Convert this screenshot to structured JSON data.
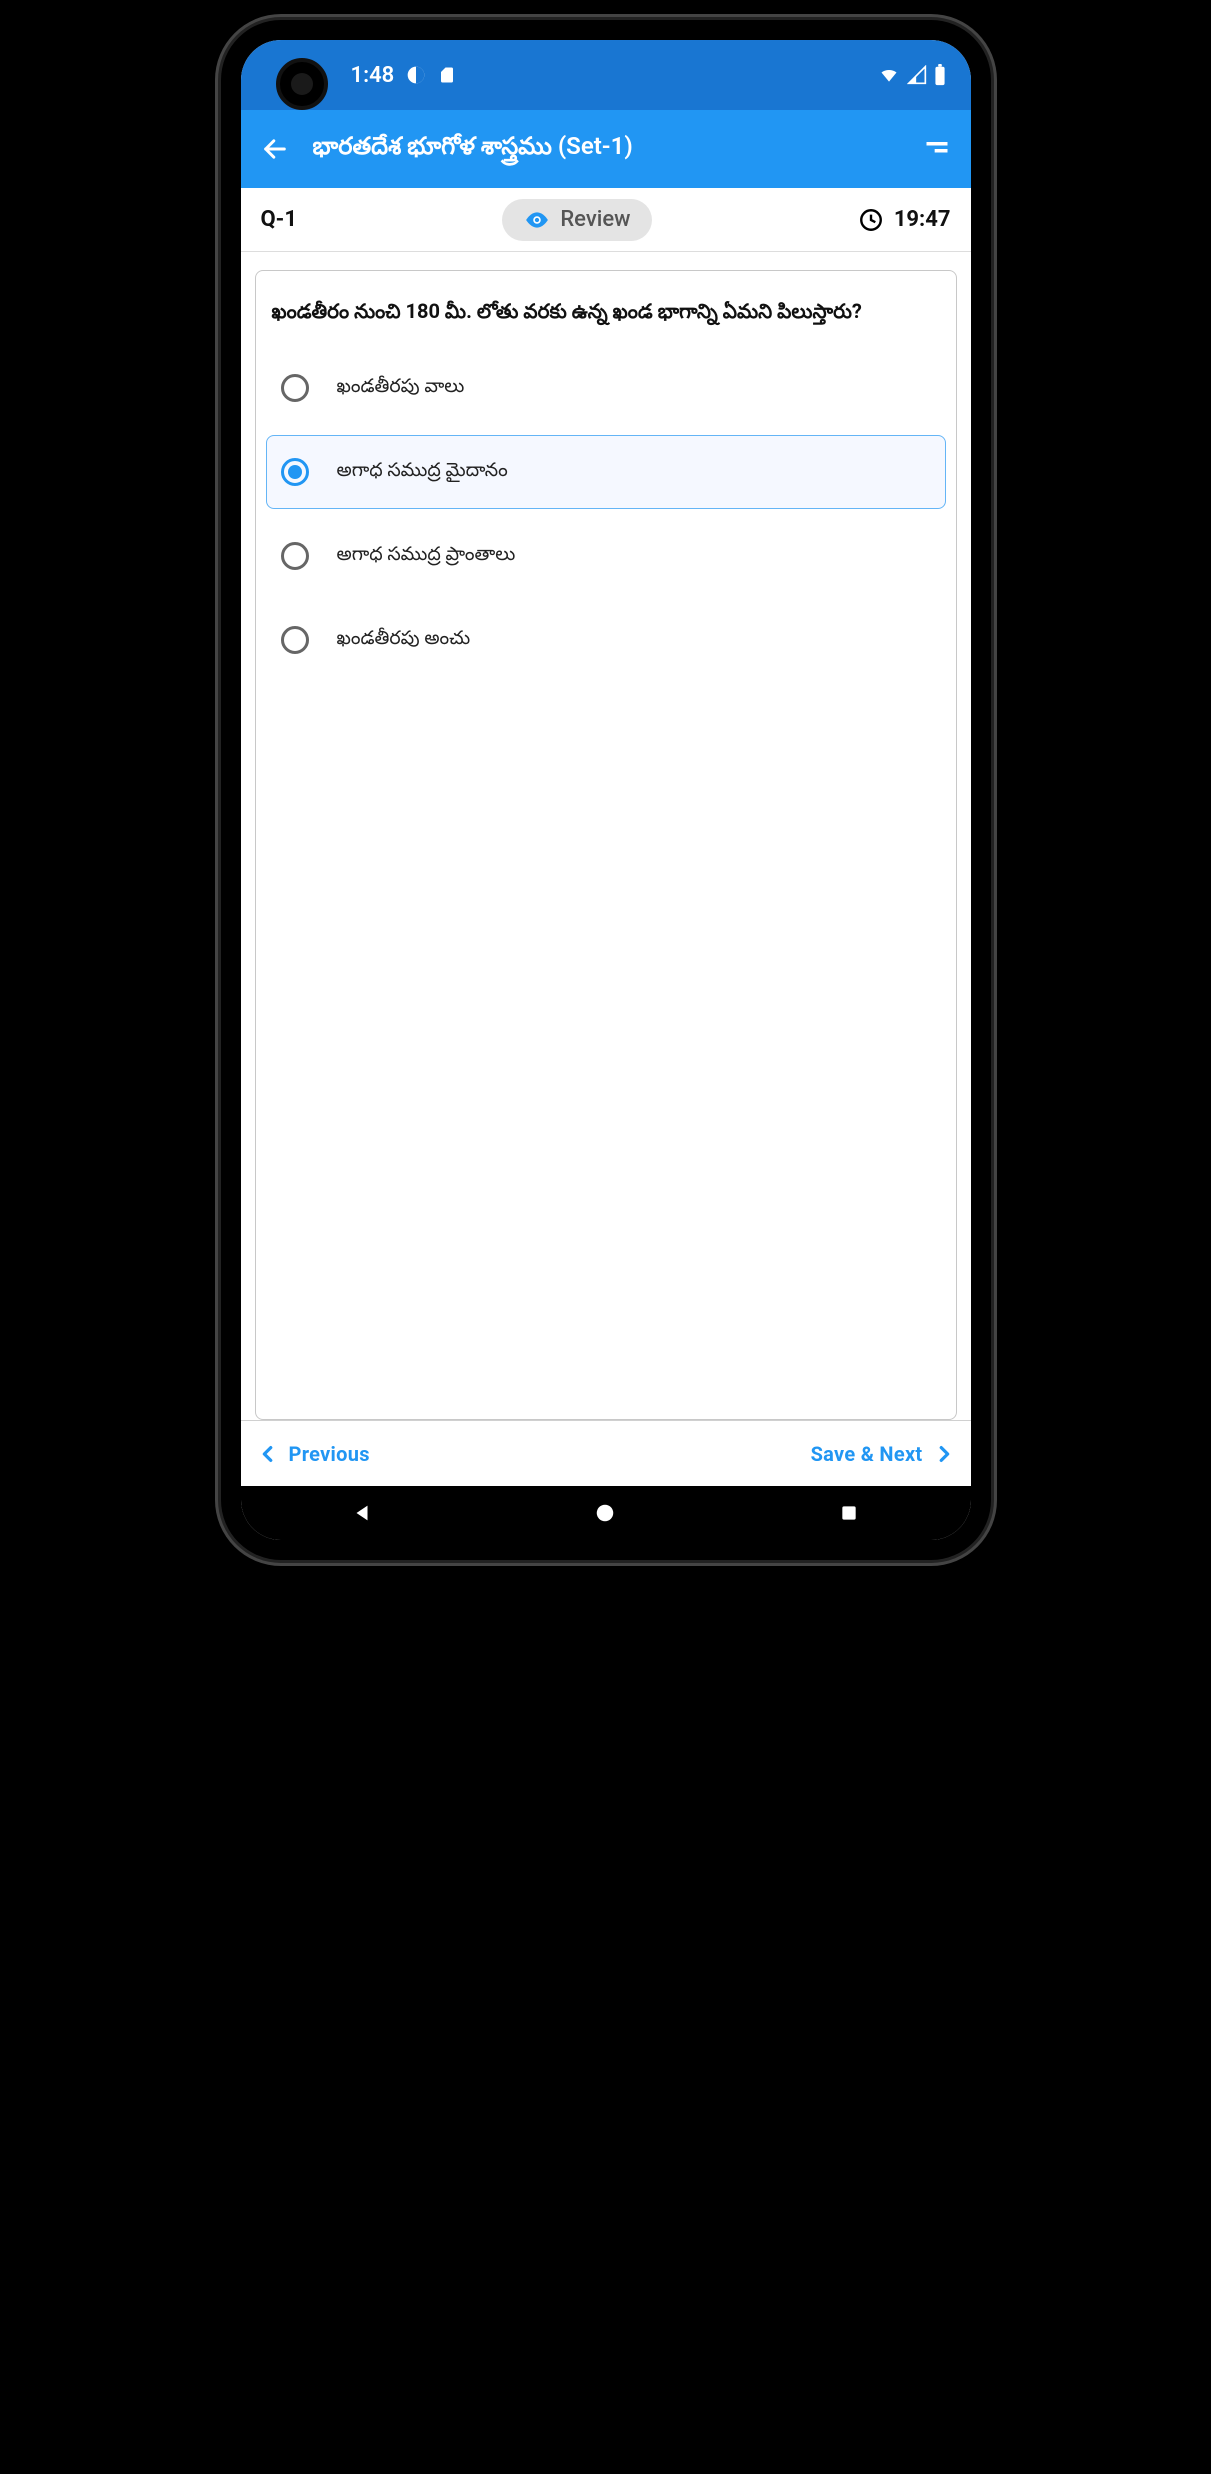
{
  "status": {
    "time": "1:48"
  },
  "header": {
    "title": "భారతదేశ భూగోళ శాస్త్రము (Set-1)"
  },
  "strip": {
    "question_number": "Q-1",
    "review_label": "Review",
    "timer": "19:47"
  },
  "question": {
    "text": "ఖండతీరం నుంచి 180 మీ. లోతు వరకు ఉన్న ఖండ భాగాన్ని ఏమని పిలుస్తారు?",
    "options": [
      {
        "label": "ఖండతీరపు వాలు",
        "selected": false
      },
      {
        "label": "అగాధ సముద్ర మైదానం",
        "selected": true
      },
      {
        "label": "అగాధ సముద్ర ప్రాంతాలు",
        "selected": false
      },
      {
        "label": "ఖండతీరపు అంచు",
        "selected": false
      }
    ]
  },
  "footer": {
    "previous": "Previous",
    "save_next": "Save & Next"
  }
}
